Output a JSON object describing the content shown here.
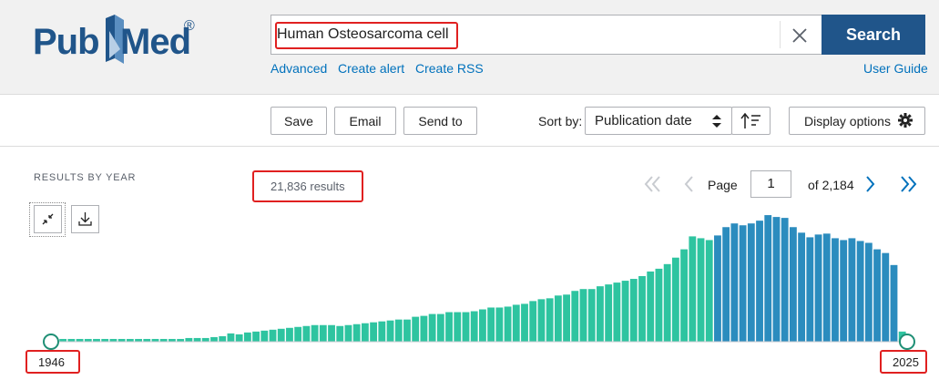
{
  "header": {
    "logo": {
      "part1": "Pub",
      "part2": "Med",
      "reg": "®"
    },
    "search": {
      "value": "Human Osteosarcoma cell",
      "placeholder": "",
      "button_label": "Search"
    },
    "links": [
      "Advanced",
      "Create alert",
      "Create RSS"
    ],
    "user_guide": "User Guide"
  },
  "toolbar": {
    "save_label": "Save",
    "email_label": "Email",
    "send_to_label": "Send to",
    "sort_by_label": "Sort by:",
    "sort_value": "Publication date",
    "display_options_label": "Display options"
  },
  "results": {
    "by_year_label": "RESULTS BY YEAR",
    "count_text": "21,836 results",
    "page_label": "Page",
    "page_value": "1",
    "page_of": "of 2,184"
  },
  "colors": {
    "brand": "#20558a",
    "link": "#0071bc",
    "bar_recent": "#2b8cbe",
    "bar_old": "#2ec4a0",
    "highlight": "#e02020"
  },
  "chart_data": {
    "type": "bar",
    "x_start": 1946,
    "x_end": 2025,
    "range_labels": [
      "1946",
      "2025"
    ],
    "values": [
      3,
      3,
      3,
      3,
      3,
      3,
      3,
      3,
      3,
      3,
      3,
      3,
      3,
      3,
      3,
      3,
      4,
      4,
      4,
      5,
      6,
      9,
      8,
      10,
      11,
      12,
      13,
      14,
      15,
      16,
      17,
      18,
      18,
      18,
      17,
      18,
      19,
      20,
      21,
      22,
      23,
      24,
      24,
      27,
      28,
      30,
      30,
      32,
      32,
      32,
      33,
      35,
      37,
      37,
      38,
      40,
      41,
      44,
      46,
      47,
      50,
      51,
      55,
      57,
      57,
      60,
      62,
      64,
      66,
      68,
      71,
      76,
      79,
      84,
      91,
      100,
      114,
      112,
      110,
      115,
      124,
      128,
      126,
      128,
      131,
      137,
      135,
      134,
      124,
      118,
      113,
      116,
      117,
      112,
      110,
      112,
      109,
      107,
      100,
      96,
      83,
      11
    ],
    "ylim": [
      0,
      142
    ],
    "recent_highlight_from_index": 79
  }
}
